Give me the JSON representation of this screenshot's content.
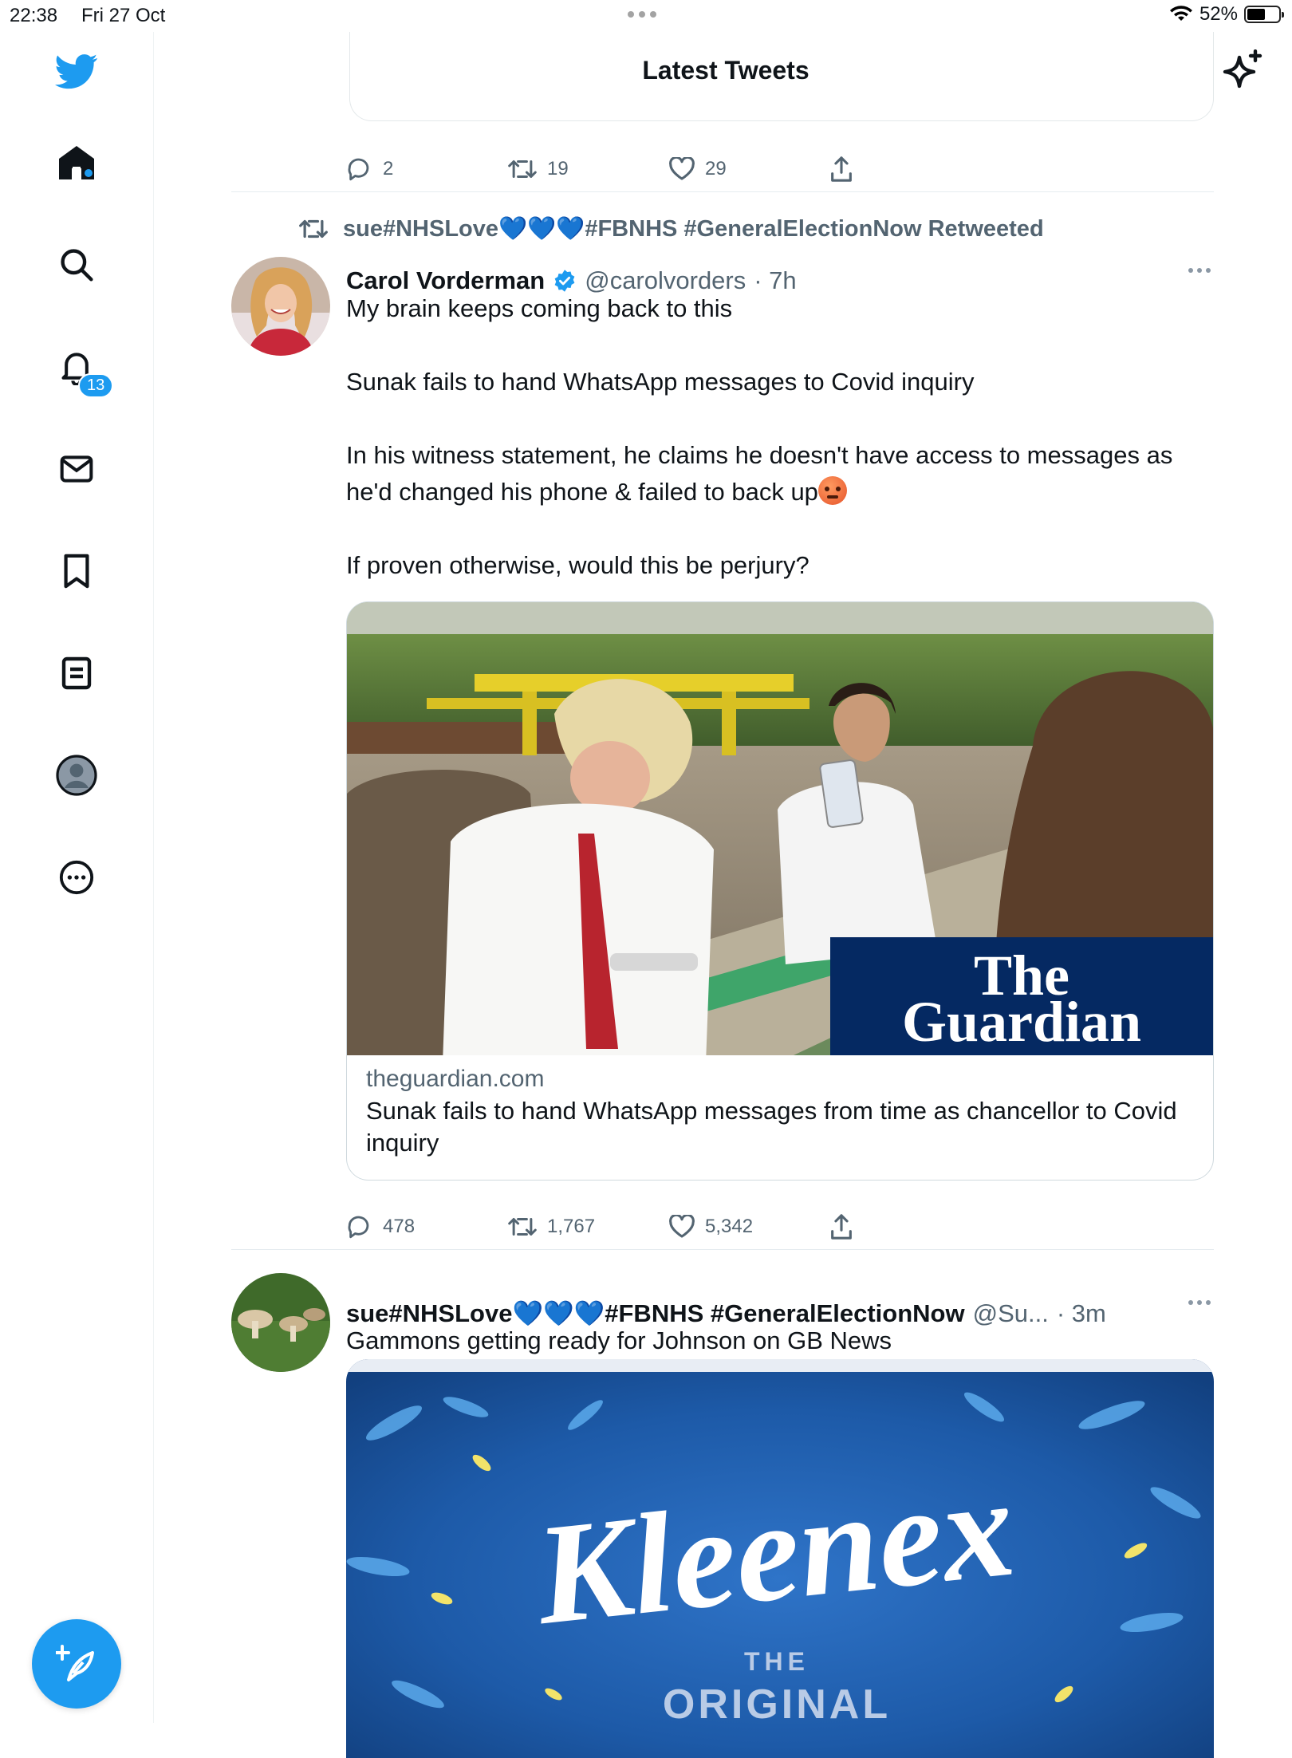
{
  "status_bar": {
    "time": "22:38",
    "date": "Fri 27 Oct",
    "battery": "52%",
    "battery_level": 0.52
  },
  "header": {
    "title": "Latest Tweets"
  },
  "sidebar": {
    "items": [
      {
        "name": "home",
        "icon": "home-icon"
      },
      {
        "name": "explore",
        "icon": "search-icon"
      },
      {
        "name": "notifications",
        "icon": "bell-icon",
        "badge": "13"
      },
      {
        "name": "messages",
        "icon": "envelope-icon"
      },
      {
        "name": "bookmarks",
        "icon": "bookmark-icon"
      },
      {
        "name": "lists",
        "icon": "list-icon"
      },
      {
        "name": "profile",
        "icon": "profile-icon"
      },
      {
        "name": "more",
        "icon": "more-circle-icon"
      }
    ],
    "compose_icon": "compose-feather-icon"
  },
  "previous_tweet": {
    "replies": "2",
    "retweets": "19",
    "likes": "29"
  },
  "tweets": [
    {
      "retweeted_by": "sue#NHSLove💙💙💙#FBNHS #GeneralElectionNow Retweeted",
      "name": "Carol Vorderman",
      "verified": true,
      "handle": "@carolvorders",
      "time": "· 7h",
      "text_lines": [
        "My brain keeps coming back to this",
        "Sunak fails to hand WhatsApp messages to Covid inquiry",
        "In his witness statement, he claims he doesn't have access to messages as he'd changed his phone & failed to back up"
      ],
      "text_last": "If proven otherwise, would this be perjury?",
      "card": {
        "brand_top": "The",
        "brand_bottom": "Guardian",
        "domain": "theguardian.com",
        "title": "Sunak fails to hand WhatsApp messages from time as chancellor to Covid inquiry"
      },
      "replies": "478",
      "retweets": "1,767",
      "likes": "5,342"
    },
    {
      "name": "sue#NHSLove💙💙💙#FBNHS #GeneralElectionNow",
      "handle": "@Su...",
      "time": "· 3m",
      "text": "Gammons getting ready for Johnson on GB News",
      "image": {
        "brand": "Kleenex",
        "sub1": "THE",
        "sub2": "ORIGINAL"
      }
    }
  ],
  "colors": {
    "accent": "#1d9bf0",
    "text": "#0f1419",
    "muted": "#536471",
    "guardian": "#052962"
  }
}
